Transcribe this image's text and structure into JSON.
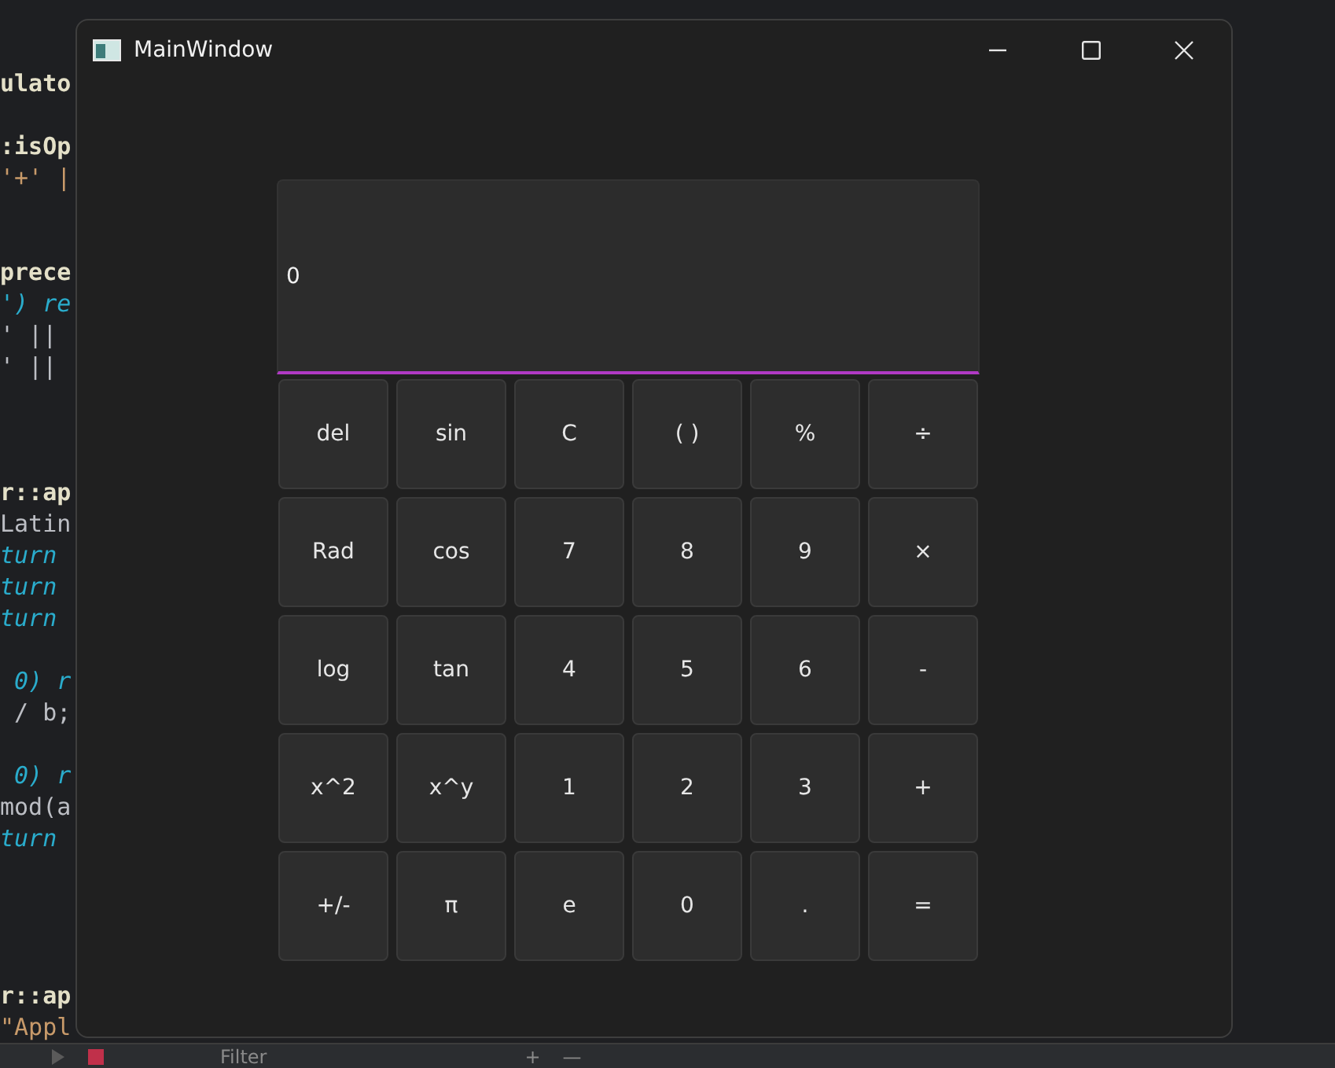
{
  "editor": {
    "lines": [
      {
        "kind": "bold",
        "text": "ulato"
      },
      {
        "kind": "blank"
      },
      {
        "kind": "bold",
        "text": ":isOp"
      },
      {
        "kind": "string",
        "text": "'+' |"
      },
      {
        "kind": "blank"
      },
      {
        "kind": "blank"
      },
      {
        "kind": "bold",
        "text": "prece"
      },
      {
        "kind": "keyword",
        "text": "') re"
      },
      {
        "kind": "plain",
        "text": "' ||"
      },
      {
        "kind": "plain",
        "text": "' ||"
      },
      {
        "kind": "blank"
      },
      {
        "kind": "blank"
      },
      {
        "kind": "blank"
      },
      {
        "kind": "bold",
        "text": "r::ap"
      },
      {
        "kind": "plain",
        "text": "Latin"
      },
      {
        "kind": "keyword",
        "text": "turn"
      },
      {
        "kind": "keyword",
        "text": "turn"
      },
      {
        "kind": "keyword",
        "text": "turn"
      },
      {
        "kind": "blank"
      },
      {
        "kind": "keyword",
        "text": " 0) r"
      },
      {
        "kind": "plain",
        "text": " / b;"
      },
      {
        "kind": "blank"
      },
      {
        "kind": "keyword",
        "text": " 0) r"
      },
      {
        "kind": "plain",
        "text": "mod(a"
      },
      {
        "kind": "keyword",
        "text": "turn"
      },
      {
        "kind": "blank"
      },
      {
        "kind": "blank"
      },
      {
        "kind": "blank"
      },
      {
        "kind": "blank"
      },
      {
        "kind": "bold",
        "text": "r::ap"
      },
      {
        "kind": "string",
        "text": "\"Appl"
      }
    ],
    "bottom_bar": {
      "filter_placeholder": "Filter",
      "add": "+",
      "remove": "—"
    }
  },
  "window": {
    "title": "MainWindow"
  },
  "display": {
    "value": "0"
  },
  "keys": [
    [
      "del",
      "sin",
      "C",
      "( )",
      "%",
      "÷"
    ],
    [
      "Rad",
      "cos",
      "7",
      "8",
      "9",
      "×"
    ],
    [
      "log",
      "tan",
      "4",
      "5",
      "6",
      "-"
    ],
    [
      "x^2",
      "x^y",
      "1",
      "2",
      "3",
      "+"
    ],
    [
      "+/-",
      "π",
      "e",
      "0",
      ".",
      "="
    ]
  ]
}
